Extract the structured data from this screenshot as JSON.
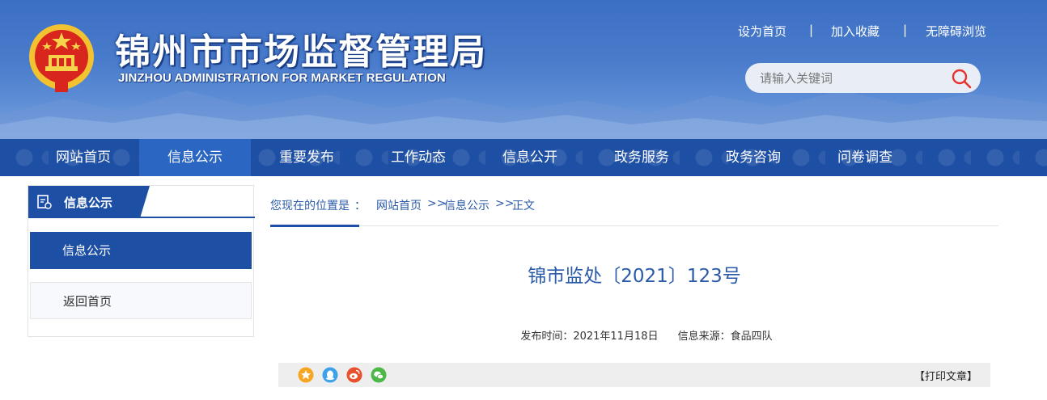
{
  "header": {
    "title": "锦州市市场监督管理局",
    "subtitle": "JINZHOU ADMINISTRATION FOR MARKET REGULATION",
    "emblem_icon": "national-emblem-icon",
    "top_links": {
      "set_home": "设为首页",
      "sep1": "|",
      "bookmark": "加入收藏",
      "sep2": "|",
      "accessible": "无障碍浏览"
    },
    "search": {
      "placeholder": "请输入关键词",
      "icon": "search-icon"
    },
    "colors": {
      "header_bg": "#3c6fc4",
      "nav_bg": "#1d4fa4",
      "nav_active": "#2b66c2",
      "search_icon": "#e8322e"
    }
  },
  "nav": {
    "items": [
      {
        "label": "网站首页"
      },
      {
        "label": "信息公示",
        "active": true
      },
      {
        "label": "重要发布"
      },
      {
        "label": "工作动态"
      },
      {
        "label": "信息公开"
      },
      {
        "label": "政务服务"
      },
      {
        "label": "政务咨询"
      },
      {
        "label": "问卷调查"
      }
    ]
  },
  "sidebar": {
    "heading": "信息公示",
    "heading_icon": "info-list-icon",
    "items": [
      {
        "label": "信息公示",
        "active": true
      },
      {
        "label": "返回首页"
      }
    ]
  },
  "breadcrumb": {
    "prefix": "您现在的位置是",
    "colon": "：",
    "items": [
      "网站首页",
      ">>",
      "信息公示",
      ">>",
      "正文"
    ]
  },
  "article": {
    "title": "锦市监处〔2021〕123号",
    "publish_label": "发布时间：",
    "publish_date": "2021年11月18日",
    "source_label": "信息来源：",
    "source": "食品四队"
  },
  "share": {
    "icons": [
      "favorite-star-icon",
      "qq-icon",
      "weibo-icon",
      "wechat-icon"
    ],
    "print_label": "【打印文章】"
  }
}
